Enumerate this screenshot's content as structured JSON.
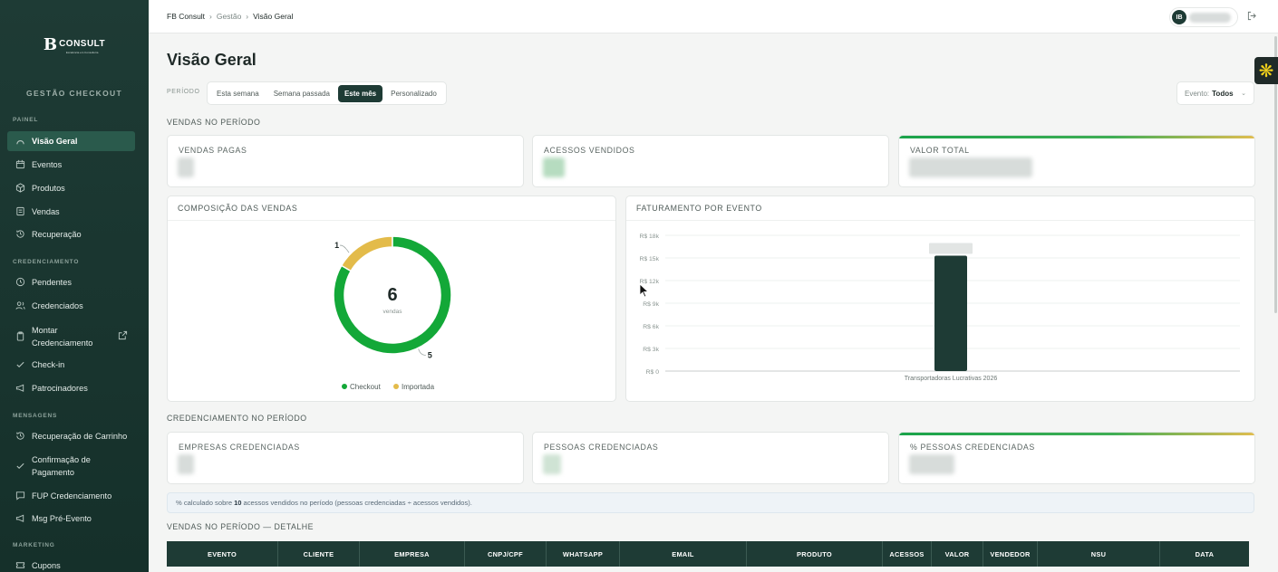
{
  "sidebar": {
    "brand_mark": "B",
    "brand_name": "CONSULT",
    "brand_tag": "Excelência em Consultoria",
    "title": "GESTÃO CHECKOUT",
    "sections": {
      "painel": "PAINEL",
      "credenciamento": "CREDENCIAMENTO",
      "mensagens": "MENSAGENS",
      "marketing": "MARKETING"
    },
    "items": {
      "visao_geral": "Visão Geral",
      "eventos": "Eventos",
      "produtos": "Produtos",
      "vendas": "Vendas",
      "recuperacao": "Recuperação",
      "pendentes": "Pendentes",
      "credenciados": "Credenciados",
      "montar_1": "Montar",
      "montar_2": "Credenciamento",
      "checkin": "Check-in",
      "patrocinadores": "Patrocinadores",
      "recup_carrinho": "Recuperação de Carrinho",
      "confirmacao_1": "Confirmação de",
      "confirmacao_2": "Pagamento",
      "fup": "FUP Credenciamento",
      "msg_pre": "Msg Pré-Evento",
      "cupons": "Cupons"
    }
  },
  "topbar": {
    "breadcrumb": [
      "FB Consult",
      "Gestão",
      "Visão Geral"
    ],
    "user_initials": "IB"
  },
  "main": {
    "title": "Visão Geral",
    "period_label": "PERÍODO",
    "period_options": [
      "Esta semana",
      "Semana passada",
      "Este mês",
      "Personalizado"
    ],
    "period_selected": "Este mês",
    "event_filter_label": "Evento:",
    "event_filter_value": "Todos",
    "sales_section": "VENDAS NO PERÍODO",
    "kpi_sales": [
      "VENDAS PAGAS",
      "ACESSOS VENDIDOS",
      "VALOR TOTAL"
    ],
    "composition_title": "COMPOSIÇÃO DAS VENDAS",
    "revenue_title": "FATURAMENTO POR EVENTO",
    "cred_section": "CREDENCIAMENTO NO PERÍODO",
    "kpi_cred": [
      "EMPRESAS CREDENCIADAS",
      "PESSOAS CREDENCIADAS",
      "% PESSOAS CREDENCIADAS"
    ],
    "info_pre": "% calculado sobre",
    "info_count": "10",
    "info_post": "acessos vendidos no período (pessoas credenciadas ÷ acessos vendidos).",
    "detail_section": "VENDAS NO PERÍODO — DETALHE",
    "table_columns": [
      "EVENTO",
      "CLIENTE",
      "EMPRESA",
      "CNPJ/CPF",
      "WHATSAPP",
      "EMAIL",
      "PRODUTO",
      "ACESSOS",
      "VALOR",
      "VENDEDOR",
      "NSU",
      "DATA"
    ]
  },
  "chart_data": [
    {
      "type": "pie",
      "title": "COMPOSIÇÃO DAS VENDAS",
      "center_value": "6",
      "center_label": "vendas",
      "categories": [
        "Checkout",
        "Importada"
      ],
      "values": [
        5,
        1
      ],
      "colors": [
        "#13a838",
        "#e3bb4a"
      ],
      "legend": "bottom"
    },
    {
      "type": "bar",
      "title": "FATURAMENTO POR EVENTO",
      "categories": [
        "Transportadoras Lucrativas 2026"
      ],
      "values": [
        15300
      ],
      "ylim": [
        0,
        18000
      ],
      "yticks": [
        "R$ 0",
        "R$ 3k",
        "R$ 6k",
        "R$ 9k",
        "R$ 12k",
        "R$ 15k",
        "R$ 18k"
      ],
      "grid": true,
      "bar_color": "#1e3b35"
    }
  ]
}
